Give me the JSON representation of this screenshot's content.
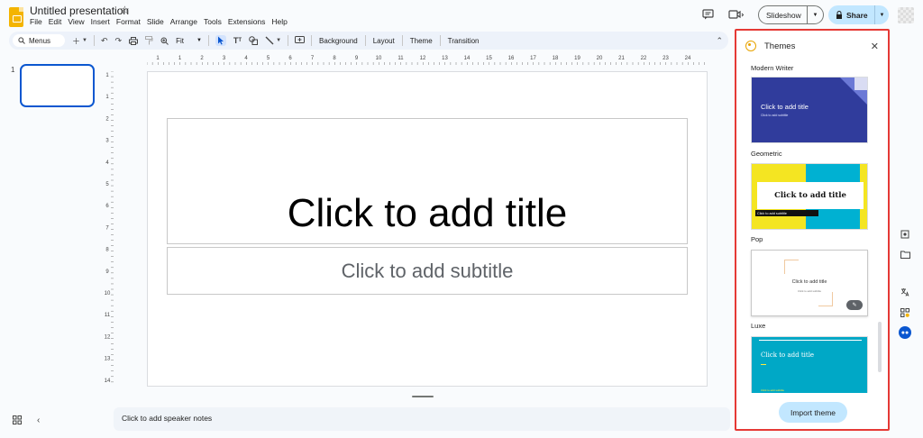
{
  "app": {
    "title": "Untitled presentation",
    "menus": [
      "File",
      "Edit",
      "View",
      "Insert",
      "Format",
      "Slide",
      "Arrange",
      "Tools",
      "Extensions",
      "Help"
    ]
  },
  "header": {
    "slideshow_label": "Slideshow",
    "share_label": "Share"
  },
  "toolbar": {
    "search_label": "Menus",
    "zoom_value": "Fit",
    "background_label": "Background",
    "layout_label": "Layout",
    "theme_label": "Theme",
    "transition_label": "Transition"
  },
  "filmstrip": {
    "slide_number": "1"
  },
  "ruler": {
    "horizontal_ticks": [
      "1",
      "1",
      "2",
      "3",
      "4",
      "5",
      "6",
      "7",
      "8",
      "9",
      "10",
      "11",
      "12",
      "13",
      "14",
      "15",
      "16",
      "17",
      "18",
      "19",
      "20",
      "21",
      "22",
      "23",
      "24",
      "25"
    ],
    "vertical_ticks": [
      "1",
      "1",
      "2",
      "3",
      "4",
      "5",
      "6",
      "7",
      "8",
      "9",
      "10",
      "11",
      "12",
      "13",
      "14"
    ]
  },
  "slide": {
    "title_placeholder": "Click to add title",
    "subtitle_placeholder": "Click to add subtitle"
  },
  "notes": {
    "placeholder": "Click to add speaker notes"
  },
  "themes_panel": {
    "title": "Themes",
    "import_label": "Import theme",
    "themes": [
      {
        "name": "Modern Writer",
        "preview_title": "Click to add title",
        "preview_subtitle": "Click to add subtitle"
      },
      {
        "name": "Geometric",
        "preview_title": "Click to add title",
        "preview_subtitle": "Click to add subtitle"
      },
      {
        "name": "Pop",
        "preview_title": "Click to add title",
        "preview_subtitle": "Click to add subtitle"
      },
      {
        "name": "Luxe",
        "preview_title": "Click to add title",
        "preview_subtitle": "Click to add subtitle"
      }
    ]
  },
  "colors": {
    "accent": "#0b57d0",
    "share_button": "#c2e7ff",
    "panel_highlight": "#e53935"
  }
}
